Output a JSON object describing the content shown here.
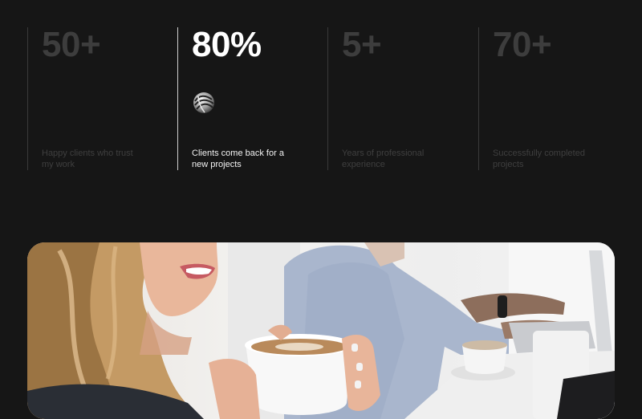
{
  "stats": [
    {
      "value": "50+",
      "label": "Happy clients who trust my work"
    },
    {
      "value": "80%",
      "label": "Clients come back for a new projects"
    },
    {
      "value": "5+",
      "label": "Years of professional experience"
    },
    {
      "value": "70+",
      "label": "Successfully completed projects"
    }
  ],
  "icons": {
    "badge": "abstract-swirl-icon"
  },
  "colors": {
    "background": "#161616",
    "muted_text": "#3d3d3d",
    "active_text": "#ffffff"
  }
}
